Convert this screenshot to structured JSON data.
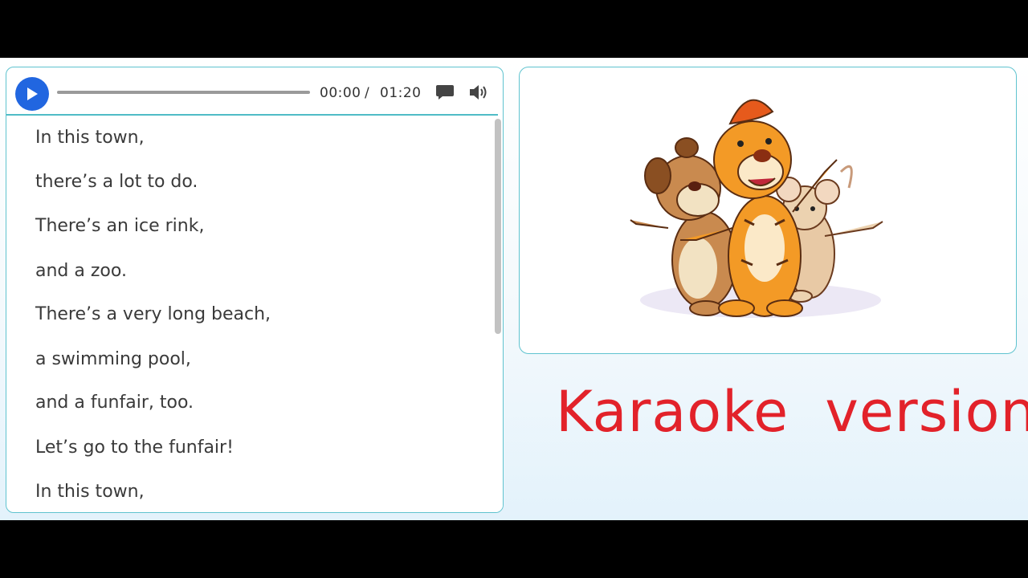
{
  "player": {
    "current_time": "00:00",
    "separator": "/",
    "total_time": "01:20",
    "progress": 0,
    "play_icon": "play-icon",
    "captions_icon": "speech-bubble-icon",
    "volume_icon": "speaker-volume-icon",
    "accent_color": "#2166e0"
  },
  "lyrics": [
    "In this town,",
    "there’s a lot to do.",
    "There’s an ice rink,",
    "and a zoo.",
    "There’s a very long beach,",
    "a swimming pool,",
    "and a funfair, too.",
    "Let’s go to the funfair!",
    "In this town,"
  ],
  "illustration": {
    "characters": [
      "dog",
      "tiger",
      "mouse"
    ]
  },
  "title": {
    "text": "Karaoke version",
    "color": "#e2222a"
  }
}
